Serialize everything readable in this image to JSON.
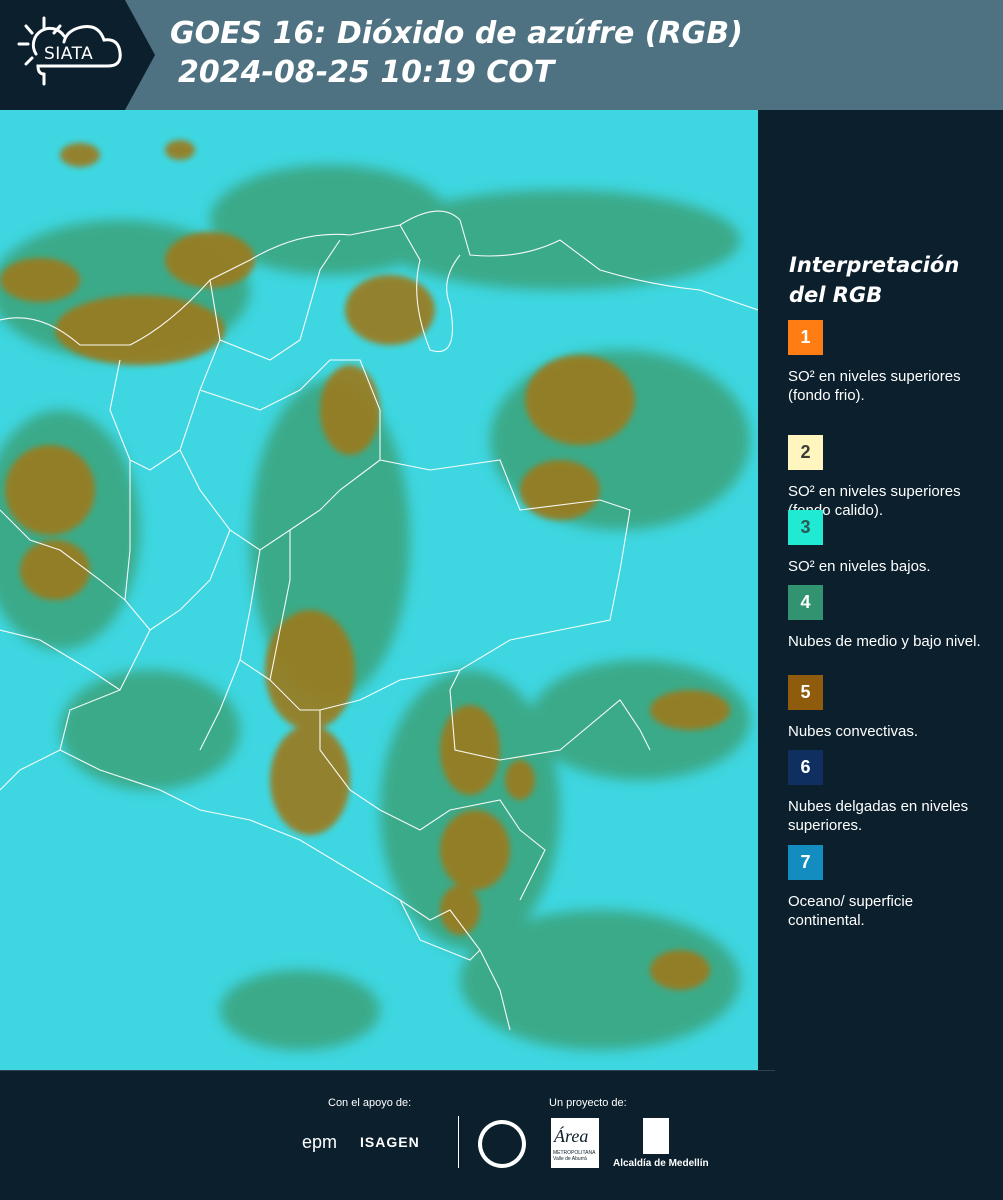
{
  "header": {
    "logo_text": "SIATA",
    "title_line1": "GOES 16: Dióxido de azúfre (RGB)",
    "title_line2": "2024-08-25 10:19 COT"
  },
  "map": {
    "icon": "satellite-map-image",
    "colors": {
      "ocean": "#3ed6e0",
      "low_level": "#3aa37a",
      "convective": "#9c7a1f",
      "border": "#ffffff"
    }
  },
  "legend": {
    "title_line1": "Interpretación",
    "title_line2": "del RGB",
    "items": [
      {
        "number": "1",
        "color": "#ff7d12",
        "text_color": "#ffffff",
        "text": "SO² en niveles superiores (fondo frio)."
      },
      {
        "number": "2",
        "color": "#fff5bf",
        "text_color": "#3a3a3a",
        "text": "SO² en niveles superiores (fondo calido)."
      },
      {
        "number": "3",
        "color": "#20ead2",
        "text_color": "#2a5a55",
        "text": "SO² en niveles bajos."
      },
      {
        "number": "4",
        "color": "#31936f",
        "text_color": "#ffffff",
        "text": "Nubes de medio y bajo nivel."
      },
      {
        "number": "5",
        "color": "#8f5b0c",
        "text_color": "#ffffff",
        "text": "Nubes convectivas."
      },
      {
        "number": "6",
        "color": "#0e2f60",
        "text_color": "#ffffff",
        "text": "Nubes delgadas en niveles superiores."
      },
      {
        "number": "7",
        "color": "#138dc0",
        "text_color": "#ffffff",
        "text": "Oceano/ superficie continental."
      }
    ]
  },
  "footer": {
    "support_label": "Con el apoyo de:",
    "project_label": "Un proyecto de:",
    "epm": "epm",
    "isagen": "ISAGEN",
    "area_logo_text": "Área",
    "area_sub": "METROPOLITANA Valle de Aburrá",
    "alcaldia": "Alcaldía de Medellín"
  }
}
